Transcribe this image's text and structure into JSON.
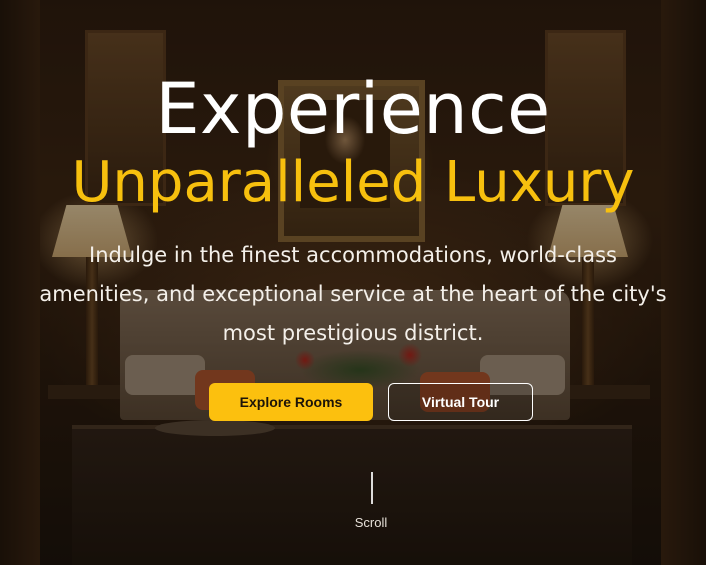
{
  "hero": {
    "title_line1": "Experience",
    "title_line2": "Unparalleled Luxury",
    "subtitle_lines": [
      "Indulge in the finest accommodations, world-class",
      "amenities, and exceptional service at the heart of the city's",
      "most prestigious district."
    ],
    "primary_button_label": "Explore Rooms",
    "secondary_button_label": "Virtual Tour",
    "scroll_label": "Scroll"
  },
  "colors": {
    "accent": "#fcc00e",
    "title_white": "#ffffff",
    "title_gold": "#f7c00e"
  },
  "background_image": "hotel-lobby-photo"
}
